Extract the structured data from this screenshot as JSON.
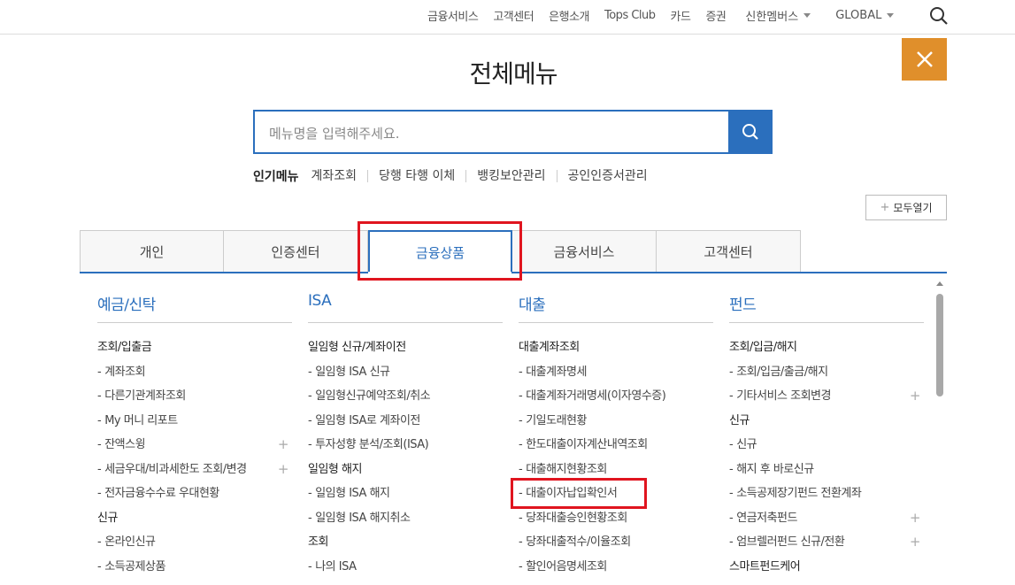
{
  "topnav": {
    "items": [
      "금융서비스",
      "고객센터",
      "은행소개",
      "Tops Club",
      "카드",
      "증권"
    ],
    "dropdown1": "신한멤버스",
    "dropdown2": "GLOBAL"
  },
  "page_title": "전체메뉴",
  "search": {
    "placeholder": "메뉴명을 입력해주세요."
  },
  "popular": {
    "title": "인기메뉴",
    "items": [
      "계좌조회",
      "당행 타행 이체",
      "뱅킹보안관리",
      "공인인증서관리"
    ]
  },
  "open_all_label": "모두열기",
  "tabs": [
    "개인",
    "인증센터",
    "금융상품",
    "금융서비스",
    "고객센터"
  ],
  "columns": [
    {
      "title": "예금/신탁",
      "groups": [
        {
          "name": "조회/입출금",
          "links": [
            {
              "label": "계좌조회",
              "expand": false
            },
            {
              "label": "다른기관계좌조회",
              "expand": false
            },
            {
              "label": "My 머니 리포트",
              "expand": false
            },
            {
              "label": "잔액스윙",
              "expand": true
            },
            {
              "label": "세금우대/비과세한도 조회/변경",
              "expand": true
            },
            {
              "label": "전자금융수수료 우대현황",
              "expand": false
            }
          ]
        },
        {
          "name": "신규",
          "links": [
            {
              "label": "온라인신규",
              "expand": false
            },
            {
              "label": "소득공제상품",
              "expand": false
            }
          ]
        }
      ]
    },
    {
      "title": "ISA",
      "groups": [
        {
          "name": "일임형 신규/계좌이전",
          "links": [
            {
              "label": "일임형 ISA 신규",
              "expand": false
            },
            {
              "label": "일임형신규예약조회/취소",
              "expand": false
            },
            {
              "label": "일임형 ISA로 계좌이전",
              "expand": false
            },
            {
              "label": "투자성향 분석/조회(ISA)",
              "expand": false
            }
          ]
        },
        {
          "name": "일임형 해지",
          "links": [
            {
              "label": "일임형 ISA 해지",
              "expand": false
            },
            {
              "label": "일임형 ISA 해지취소",
              "expand": false
            }
          ]
        },
        {
          "name": "조회",
          "links": [
            {
              "label": "나의 ISA",
              "expand": false
            }
          ]
        }
      ]
    },
    {
      "title": "대출",
      "groups": [
        {
          "name": "대출계좌조회",
          "links": [
            {
              "label": "대출계좌명세",
              "expand": false
            },
            {
              "label": "대출계좌거래명세(이자영수증)",
              "expand": false
            },
            {
              "label": "기일도래현황",
              "expand": false
            },
            {
              "label": "한도대출이자계산내역조회",
              "expand": false
            },
            {
              "label": "대출해지현황조회",
              "expand": false
            },
            {
              "label": "대출이자납입확인서",
              "expand": false
            },
            {
              "label": "당좌대출승인현황조회",
              "expand": false
            },
            {
              "label": "당좌대출적수/이율조회",
              "expand": false
            },
            {
              "label": "할인어음명세조회",
              "expand": false
            }
          ]
        }
      ]
    },
    {
      "title": "펀드",
      "groups": [
        {
          "name": "조회/입금/해지",
          "links": [
            {
              "label": "조회/입금/출금/해지",
              "expand": false
            },
            {
              "label": "기타서비스 조회변경",
              "expand": true
            }
          ]
        },
        {
          "name": "신규",
          "links": [
            {
              "label": "신규",
              "expand": false
            },
            {
              "label": "해지 후 바로신규",
              "expand": false
            },
            {
              "label": "소득공제장기펀드 전환계좌",
              "expand": false
            },
            {
              "label": "연금저축펀드",
              "expand": true
            },
            {
              "label": "엄브렐러펀드 신규/전환",
              "expand": true
            }
          ]
        },
        {
          "name": "스마트펀드케어",
          "links": []
        }
      ]
    }
  ]
}
